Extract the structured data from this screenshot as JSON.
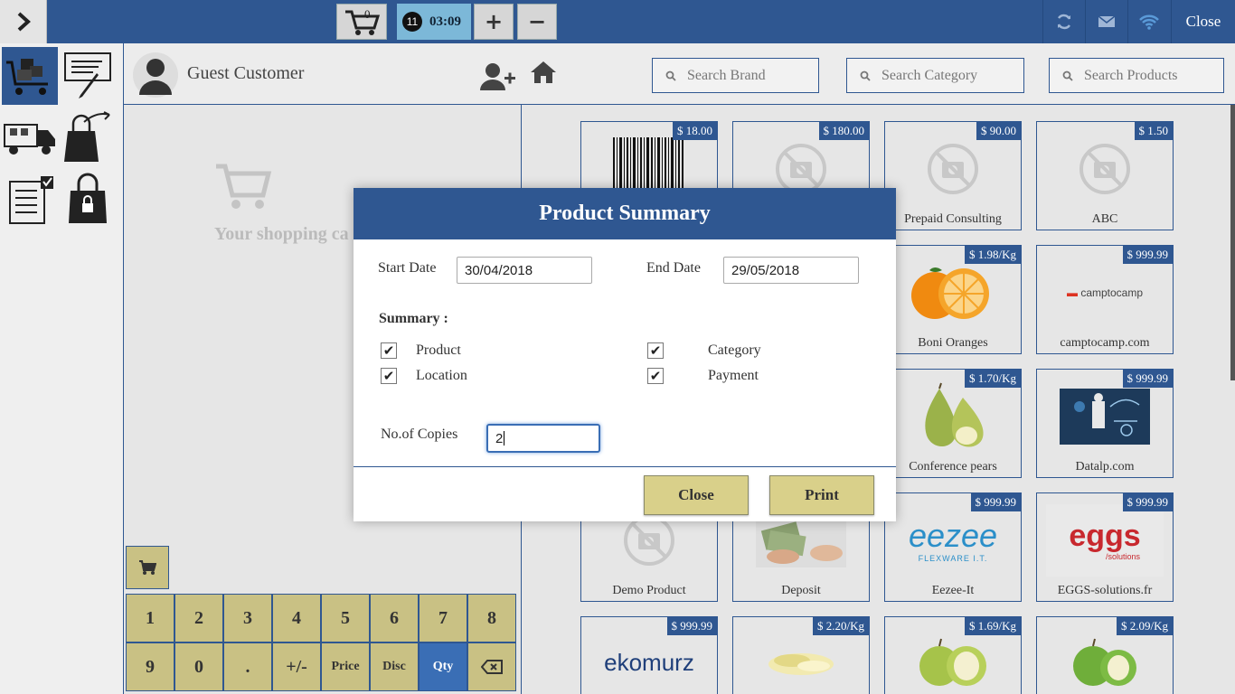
{
  "topbar": {
    "cart_count": "0",
    "session_number": "11",
    "session_time": "03:09",
    "plus": "+",
    "minus": "−",
    "close_label": "Close"
  },
  "customer": {
    "name": "Guest Customer"
  },
  "cart": {
    "empty_text": "Your shopping ca"
  },
  "numpad": {
    "keys": [
      "1",
      "2",
      "3",
      "4",
      "5",
      "6",
      "7",
      "8",
      "9",
      "0",
      ".",
      "+/-",
      "Price",
      "Disc",
      "Qty"
    ]
  },
  "search": {
    "brand_placeholder": "Search Brand",
    "category_placeholder": "Search Category",
    "products_placeholder": "Search Products"
  },
  "products": [
    {
      "name": "",
      "price": "$ 18.00"
    },
    {
      "name": "",
      "price": "$ 180.00"
    },
    {
      "name": "Prepaid Consulting",
      "price": "$ 90.00"
    },
    {
      "name": "ABC",
      "price": "$ 1.50"
    },
    {
      "name": "Boni Oranges",
      "price": "$ 1.98/Kg"
    },
    {
      "name": "camptocamp.com",
      "price": "$ 999.99",
      "logo": "camptocamp"
    },
    {
      "name": "Conference pears",
      "price": "$ 1.70/Kg"
    },
    {
      "name": "Datalp.com",
      "price": "$ 999.99"
    },
    {
      "name": "Demo Product",
      "price": ""
    },
    {
      "name": "Deposit",
      "price": ""
    },
    {
      "name": "Eezee-It",
      "price": "$ 999.99",
      "logo_main": "eezee",
      "logo_sub": "FLEXWARE I.T."
    },
    {
      "name": "EGGS-solutions.fr",
      "price": "$ 999.99",
      "logo_main": "eggs",
      "logo_sub": "/solutions"
    },
    {
      "name": "",
      "price": "$ 999.99",
      "logo": "ekomurz"
    },
    {
      "name": "",
      "price": "$ 2.20/Kg"
    },
    {
      "name": "",
      "price": "$ 1.69/Kg"
    },
    {
      "name": "",
      "price": "$ 2.09/Kg"
    }
  ],
  "modal": {
    "title": "Product Summary",
    "start_date_label": "Start Date",
    "start_date_value": "30/04/2018",
    "end_date_label": "End Date",
    "end_date_value": "29/05/2018",
    "summary_label": "Summary :",
    "checks": [
      {
        "label": "Product",
        "checked": true
      },
      {
        "label": "Category",
        "checked": true
      },
      {
        "label": "Location",
        "checked": true
      },
      {
        "label": "Payment",
        "checked": true
      }
    ],
    "copies_label": "No.of Copies",
    "copies_value": "2",
    "close_button": "Close",
    "print_button": "Print"
  },
  "colors": {
    "primary": "#2f5791",
    "button": "#c9c184",
    "active_key": "#3a6eb5"
  }
}
